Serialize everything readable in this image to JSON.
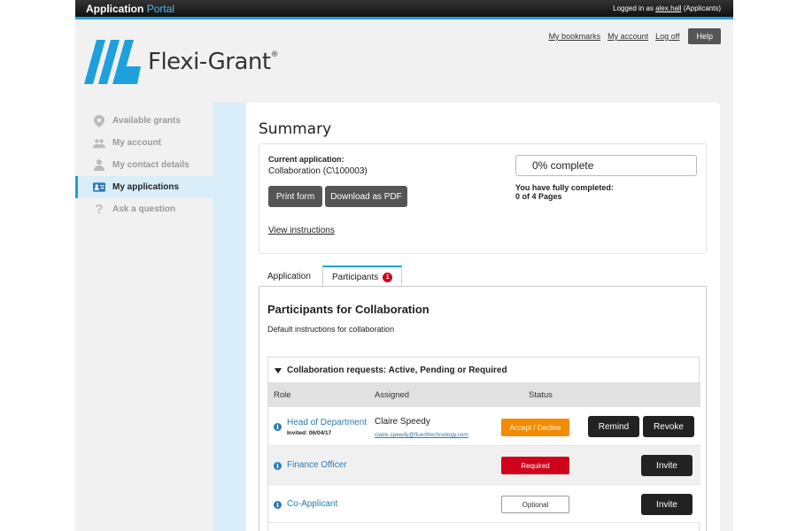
{
  "topbar": {
    "app_title_main": "Application",
    "app_title_accent": "Portal",
    "login_prefix": "Logged in as ",
    "login_user": "alex.hall",
    "login_suffix": " (Applicants)"
  },
  "header_links": {
    "bookmarks": "My bookmarks",
    "account": "My account",
    "logoff": "Log off",
    "help": "Help"
  },
  "brand": {
    "name": "Flexi-Grant",
    "mark": "®",
    "logo_color": "#1ea0dc"
  },
  "sidebar": {
    "items": [
      {
        "label": "Available grants",
        "icon": "map-pin-icon"
      },
      {
        "label": "My account",
        "icon": "users-icon"
      },
      {
        "label": "My contact details",
        "icon": "person-icon"
      },
      {
        "label": "My applications",
        "icon": "id-card-icon",
        "active": true
      },
      {
        "label": "Ask a question",
        "icon": "question-icon"
      }
    ]
  },
  "summary": {
    "title": "Summary",
    "current_label": "Current application:",
    "current_value": "Collaboration (C\\100003)",
    "print_btn": "Print form",
    "pdf_btn": "Download as PDF",
    "view_instructions": "View instructions",
    "progress_text": "0% complete",
    "progress_fraction": 0,
    "completed_label": "You have fully completed:",
    "completed_value": "0 of 4 Pages"
  },
  "tabs": [
    {
      "label": "Application"
    },
    {
      "label": "Participants",
      "badge": "1",
      "active": true
    }
  ],
  "participants": {
    "title": "Participants for Collaboration",
    "description": "Default instructions for collaboration",
    "section_title": "Collaboration requests: Active, Pending or Required",
    "columns": {
      "role": "Role",
      "assigned": "Assigned",
      "status": "Status"
    },
    "rows": [
      {
        "role": "Head of Department",
        "invited": "Invited: 06/04/17",
        "assigned_name": "Claire Speedy",
        "assigned_email": "claire.speedy@fluenttechnology.com",
        "status": "Accept / Decline",
        "status_color": "#f38b00",
        "actions": [
          "Remind",
          "Revoke"
        ]
      },
      {
        "role": "Finance Officer",
        "status": "Required",
        "status_color": "#d0021b",
        "actions": [
          "Invite"
        ]
      },
      {
        "role": "Co-Applicant",
        "status": "Optional",
        "actions": [
          "Invite"
        ]
      }
    ]
  }
}
